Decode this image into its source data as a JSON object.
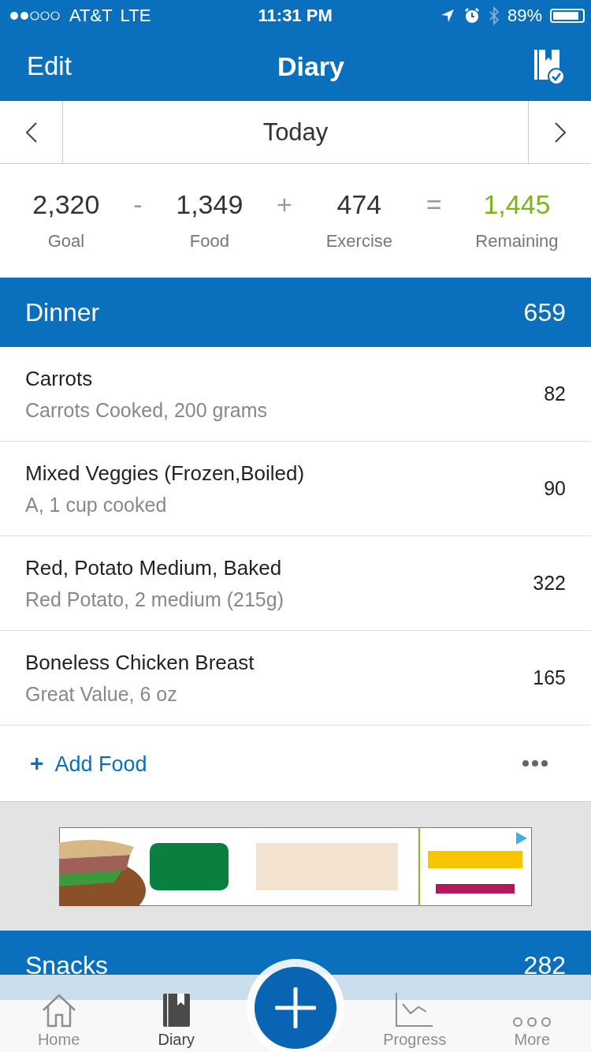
{
  "status_bar": {
    "carrier": "AT&T",
    "network": "LTE",
    "time": "11:31 PM",
    "battery": "89%"
  },
  "nav": {
    "left": "Edit",
    "title": "Diary"
  },
  "date_bar": {
    "label": "Today"
  },
  "summary": [
    {
      "value": "2,320",
      "label": "Goal",
      "kind": "plain"
    },
    {
      "op": "-",
      "kind": "op"
    },
    {
      "value": "1,349",
      "label": "Food",
      "kind": "plain"
    },
    {
      "op": "+",
      "kind": "op"
    },
    {
      "value": "474",
      "label": "Exercise",
      "kind": "plain"
    },
    {
      "op": "=",
      "kind": "op"
    },
    {
      "value": "1,445",
      "label": "Remaining",
      "kind": "good"
    }
  ],
  "meals": [
    {
      "name": "Dinner",
      "calories": "659",
      "items": [
        {
          "name": "Carrots",
          "detail": "Carrots Cooked, 200 grams",
          "calories": "82"
        },
        {
          "name": "Mixed Veggies (Frozen,Boiled)",
          "detail": "A, 1 cup cooked",
          "calories": "90"
        },
        {
          "name": "Red, Potato Medium, Baked",
          "detail": "Red Potato, 2 medium (215g)",
          "calories": "322"
        },
        {
          "name": "Boneless Chicken Breast",
          "detail": "Great Value, 6 oz",
          "calories": "165"
        }
      ],
      "add_label": "Add Food",
      "add_icon": "+",
      "ad": {
        "kind": "picture"
      }
    },
    {
      "name": "Snacks",
      "calories": "282"
    }
  ],
  "tab_bar": [
    {
      "label": "Home",
      "kind": "home",
      "selected": false
    },
    {
      "label": "Diary",
      "kind": "diary",
      "selected": true
    },
    {
      "kind": "add"
    },
    {
      "label": "Progress",
      "kind": "progress",
      "selected": false
    },
    {
      "label": "More",
      "kind": "more",
      "selected": false
    }
  ]
}
